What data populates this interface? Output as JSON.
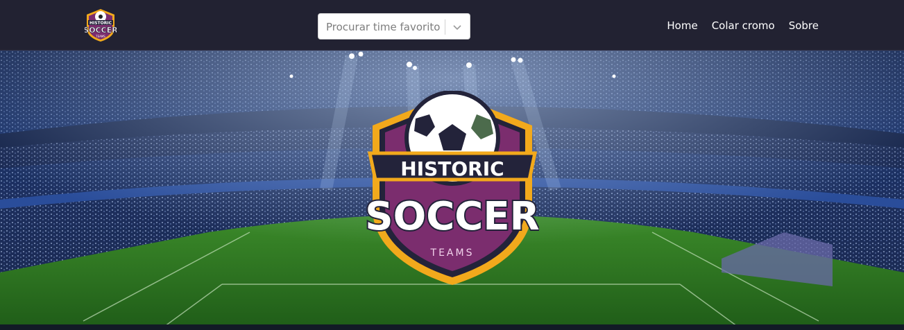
{
  "brand": {
    "logo_alt": "Historic Soccer Teams",
    "logo_top": "HISTORIC",
    "logo_main": "SOCCER",
    "logo_bottom": "TEAMS"
  },
  "search": {
    "placeholder": "Procurar time favorito",
    "icon": "chevron-down-icon"
  },
  "nav": {
    "links": [
      {
        "label": "Home"
      },
      {
        "label": "Colar cromo"
      },
      {
        "label": "Sobre"
      }
    ]
  },
  "hero": {
    "badge_top": "HISTORIC",
    "badge_main": "SOCCER",
    "badge_bottom": "TEAMS"
  },
  "colors": {
    "navbar": "#222232",
    "badge_gold": "#f2a91c",
    "badge_purple": "#7b2d6e",
    "badge_navy": "#23233a",
    "pitch": "#2e7d24"
  }
}
